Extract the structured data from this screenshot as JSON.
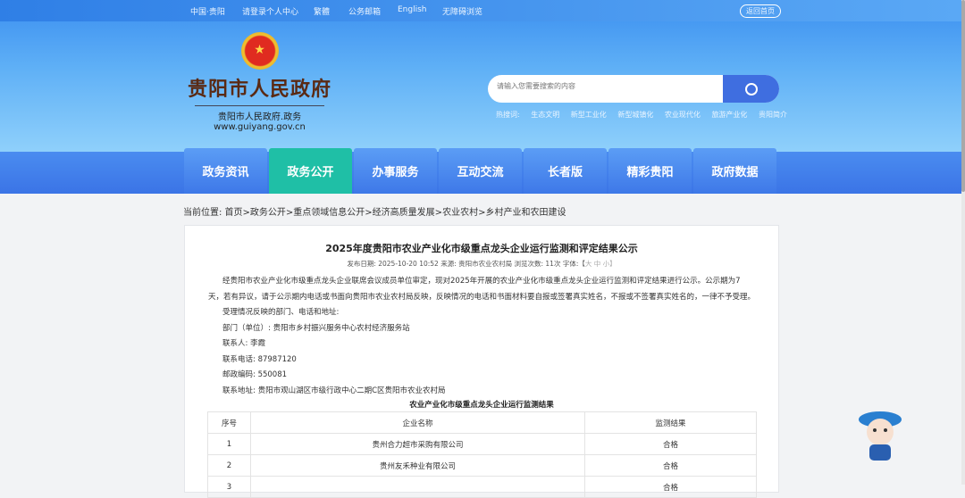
{
  "topbar": {
    "items": [
      "中国·贵阳",
      "请登录个人中心",
      "繁體",
      "公务邮箱",
      "English",
      "无障碍浏览"
    ],
    "back": "返回首页"
  },
  "logo": {
    "title": "贵阳市人民政府",
    "subtitle": "贵阳市人民政府.政务",
    "url": "www.guiyang.gov.cn"
  },
  "search": {
    "placeholder": "请输入您需要搜索的内容",
    "hot_label": "热搜词:",
    "hot": [
      "生态文明",
      "新型工业化",
      "新型城镇化",
      "农业现代化",
      "旅游产业化",
      "贵阳简介"
    ]
  },
  "nav": [
    "政务资讯",
    "政务公开",
    "办事服务",
    "互动交流",
    "长者版",
    "精彩贵阳",
    "政府数据"
  ],
  "breadcrumb": "当前位置:  首页>政务公开>重点领域信息公开>经济高质量发展>农业农村>乡村产业和农田建设",
  "article": {
    "title": "2025年度贵阳市农业产业化市级重点龙头企业运行监测和评定结果公示",
    "meta": "发布日期: 2025-10-20 10:52 来源: 贵阳市农业农村局 浏览次数: 11次 字体:【",
    "font_sizes": "大  中  小】",
    "paragraphs": [
      "经贵阳市农业产业化市级重点龙头企业联席会议成员单位审定，现对2025年开展的农业产业化市级重点龙头企业运行监测和评定结果进行公示。公示期为7天，若有异议，请于公示期内电话或书面向贵阳市农业农村局反映，反映情况的电话和书面材料要自报或签署真实姓名，不报或不签署真实姓名的，一律不予受理。",
      "受理情况反映的部门、电话和地址:",
      "部门（单位）: 贵阳市乡村振兴服务中心农村经济服务站",
      "联系人: 李霞",
      "联系电话: 87987120",
      "邮政编码: 550081",
      "联系地址: 贵阳市观山湖区市级行政中心二期C区贵阳市农业农村局"
    ],
    "table_title": "农业产业化市级重点龙头企业运行监测结果",
    "headers": [
      "序号",
      "企业名称",
      "监测结果"
    ],
    "rows": [
      [
        "1",
        "贵州合力超市采购有限公司",
        "合格"
      ],
      [
        "2",
        "贵州友禾种业有限公司",
        "合格"
      ],
      [
        "3",
        "",
        "合格"
      ]
    ]
  }
}
